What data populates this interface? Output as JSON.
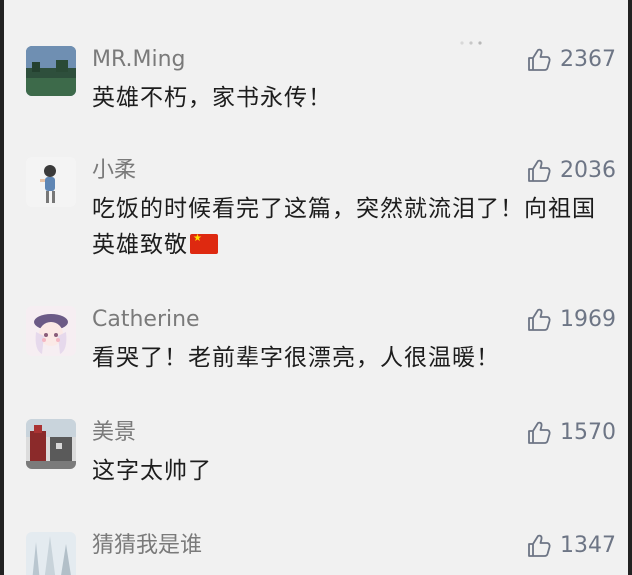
{
  "comments": [
    {
      "user": "MR.Ming",
      "likes": "2367",
      "text": "英雄不朽，家书永传！",
      "avatar": "lake-avatar-icon",
      "has_flag": false
    },
    {
      "user": "小柔",
      "likes": "2036",
      "text": "吃饭的时候看完了这篇，突然就流泪了！向祖国英雄致敬",
      "avatar": "girl-figure-avatar-icon",
      "has_flag": true
    },
    {
      "user": "Catherine",
      "likes": "1969",
      "text": "看哭了！老前辈字很漂亮，人很温暖！",
      "avatar": "anime-girl-avatar-icon",
      "has_flag": false
    },
    {
      "user": "美景",
      "likes": "1570",
      "text": "这字太帅了",
      "avatar": "landscape-avatar-icon",
      "has_flag": false
    },
    {
      "user": "猜猜我是谁",
      "likes": "1347",
      "text": "",
      "avatar": "snowy-tree-avatar-icon",
      "has_flag": false
    }
  ],
  "icons": {
    "like": "thumbs-up-icon",
    "flag": "china-flag-icon"
  },
  "colors": {
    "background": "#f1f1f1",
    "username": "#7a7a7a",
    "like_count": "#6d7585",
    "comment_text": "#1d1d1d",
    "flag_red": "#de2910"
  }
}
